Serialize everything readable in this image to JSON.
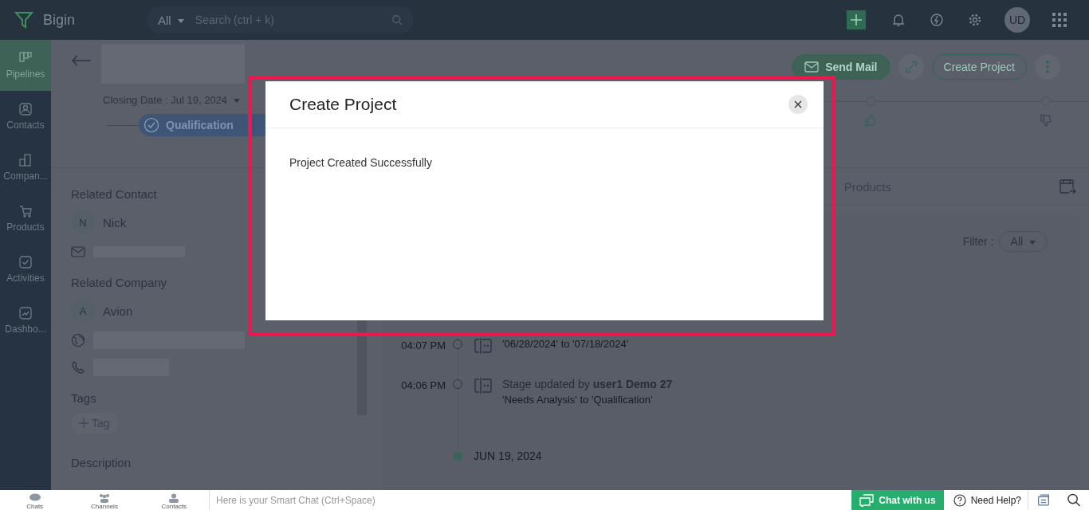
{
  "app": {
    "name": "Bigin"
  },
  "search": {
    "scope": "All",
    "placeholder": "Search (ctrl + k)"
  },
  "user": {
    "initials": "UD"
  },
  "sidebar": {
    "items": [
      {
        "label": "Pipelines",
        "selected": true,
        "kind": "pipelines"
      },
      {
        "label": "Contacts",
        "selected": false,
        "kind": "contacts"
      },
      {
        "label": "Compan...",
        "selected": false,
        "kind": "companies"
      },
      {
        "label": "Products",
        "selected": false,
        "kind": "products"
      },
      {
        "label": "Activities",
        "selected": false,
        "kind": "activities"
      },
      {
        "label": "Dashbo...",
        "selected": false,
        "kind": "dashboards"
      }
    ]
  },
  "record": {
    "closing_date": "Closing Date : Jul 19, 2024",
    "stage": "Qualification",
    "send_mail": "Send Mail",
    "create_project": "Create Project"
  },
  "related_contact": {
    "heading": "Related Contact",
    "initial": "N",
    "name": "Nick"
  },
  "related_company": {
    "heading": "Related Company",
    "initial": "A",
    "name": "Avion"
  },
  "tags": {
    "heading": "Tags",
    "add": "Tag"
  },
  "description": {
    "heading": "Description"
  },
  "tabs": [
    {
      "label": "Products",
      "selected": false
    }
  ],
  "filter": {
    "label": "Filter :",
    "value": "All"
  },
  "timeline": [
    {
      "kind": "entry",
      "time": "04:07 PM",
      "detail": "'06/28/2024' to '07/18/2024'"
    },
    {
      "kind": "entry",
      "time": "04:06 PM",
      "title": "Stage updated by **user1 Demo 27**",
      "detail": "'Needs Analysis' to 'Qualification'"
    },
    {
      "kind": "date",
      "date": "JUN 19, 2024"
    }
  ],
  "modal": {
    "title": "Create Project",
    "message": "Project Created Successfully"
  },
  "bottom_bar": {
    "tabs": [
      "Chats",
      "Channels",
      "Contacts"
    ],
    "chat_placeholder": "Here is your Smart Chat (Ctrl+Space)",
    "chat_button": "Chat with us",
    "help": "Need Help?"
  }
}
